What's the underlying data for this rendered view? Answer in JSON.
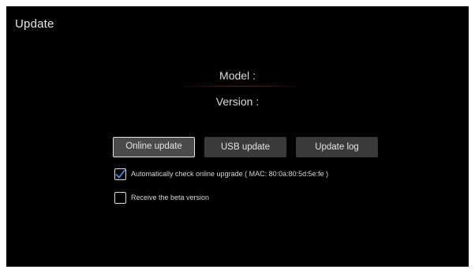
{
  "header": {
    "title": "Update"
  },
  "info": {
    "model_label": "Model :",
    "version_label": "Version :"
  },
  "buttons": {
    "online_update": "Online update",
    "usb_update": "USB update",
    "update_log": "Update log"
  },
  "options": {
    "auto_check": {
      "label": "Automatically check online upgrade ( MAC: 80:0a:80:5d:5e:fe )",
      "checked": true
    },
    "beta": {
      "label": "Receive the beta version",
      "checked": false
    }
  },
  "colors": {
    "background": "#000000",
    "button": "#3a3a3a",
    "button_focused": "#4a4a4a",
    "check_accent": "#3d8fe0",
    "text": "#e6e6e6"
  },
  "icons": {
    "checkmark": "checkmark-icon"
  }
}
